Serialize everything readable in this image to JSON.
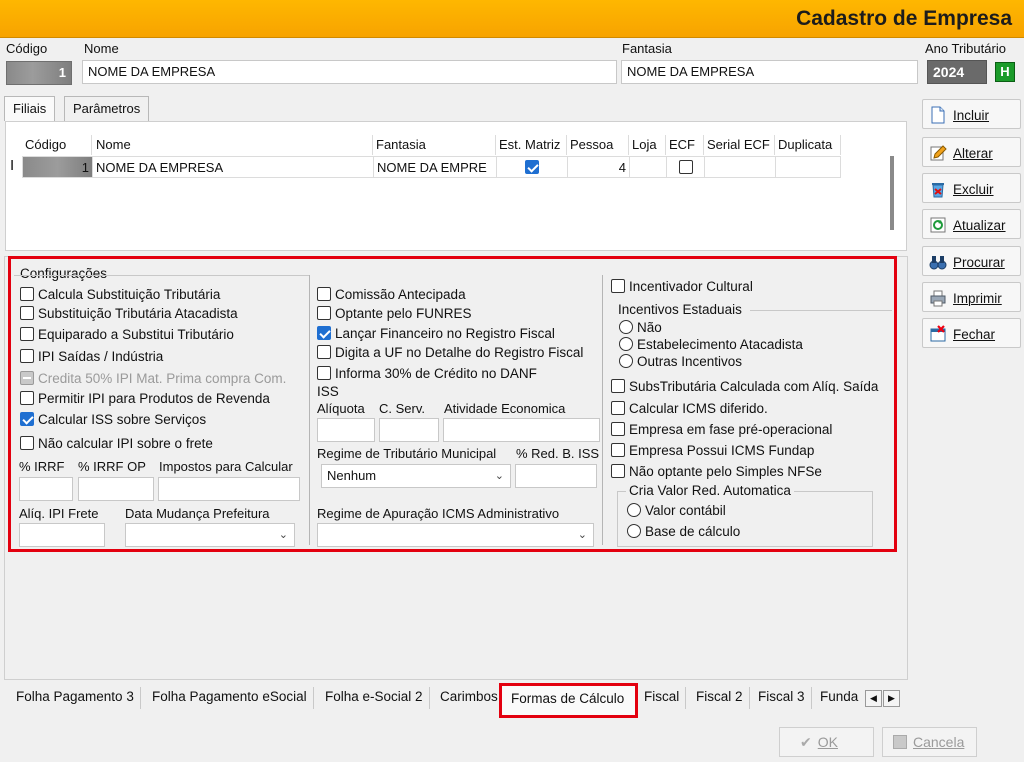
{
  "window": {
    "title": "Cadastro de Empresa"
  },
  "header": {
    "codigo_label": "Código",
    "codigo_value": "1",
    "nome_label": "Nome",
    "nome_value": "NOME DA EMPRESA",
    "fantasia_label": "Fantasia",
    "fantasia_value": "NOME DA EMPRESA",
    "ano_label": "Ano Tributário",
    "ano_value": "2024",
    "h_button": "H"
  },
  "top_tabs": [
    "Filiais",
    "Parâmetros"
  ],
  "grid": {
    "columns": [
      "Código",
      "Nome",
      "Fantasia",
      "Est. Matriz",
      "Pessoa",
      "Loja",
      "ECF",
      "Serial ECF",
      "Duplicata"
    ],
    "row": {
      "codigo": "1",
      "nome": "NOME DA EMPRESA",
      "fantasia": "NOME DA EMPRE",
      "est_matriz": true,
      "pessoa": "4",
      "loja": "",
      "ecf": false,
      "serial_ecf": "",
      "duplicata": ""
    }
  },
  "config": {
    "title": "Configurações",
    "col1": [
      {
        "label": "Calcula Substituição Tributária",
        "checked": false
      },
      {
        "label": "Substituição Tributária Atacadista",
        "checked": false
      },
      {
        "label": "Equiparado a Substitui Tributário",
        "checked": false
      },
      {
        "label": "IPI Saídas / Indústria",
        "checked": false
      },
      {
        "label": "Credita 50% IPI Mat. Prima compra Com.",
        "checked": false,
        "disabled": true
      },
      {
        "label": "Permitir IPI para Produtos de Revenda",
        "checked": false
      },
      {
        "label": "Calcular ISS sobre Serviços",
        "checked": true
      },
      {
        "label": "Não calcular IPI sobre o frete",
        "checked": false
      }
    ],
    "col1_fields": {
      "irrf": "% IRRF",
      "irrf_op": "% IRRF OP",
      "impostos": "Impostos para Calcular",
      "aliq_ipi_frete": "Alíq. IPI Frete",
      "data_mudanca": "Data Mudança Prefeitura"
    },
    "col2": [
      {
        "label": "Comissão Antecipada",
        "checked": false
      },
      {
        "label": "Optante pelo FUNRES",
        "checked": false
      },
      {
        "label": "Lançar Financeiro no Registro Fiscal",
        "checked": true
      },
      {
        "label": "Digita a UF no Detalhe do Registro Fiscal",
        "checked": false
      },
      {
        "label": "Informa 30% de Crédito no DANF",
        "checked": false
      }
    ],
    "col2_fields": {
      "iss": "ISS",
      "aliquota": "Alíquota",
      "c_serv": "C. Serv.",
      "atividade": "Atividade Economica",
      "regime_municipal": "Regime de Tributário Municipal",
      "regime_municipal_value": "Nenhum",
      "red_b_iss": "% Red. B. ISS",
      "regime_icms": "Regime de Apuração ICMS Administrativo"
    },
    "col3": {
      "incentivador": {
        "label": "Incentivador Cultural",
        "checked": false
      },
      "incentivos_title": "Incentivos Estaduais",
      "incentivos": [
        "Não",
        "Estabelecimento Atacadista",
        "Outras Incentivos"
      ],
      "checks": [
        {
          "label": "SubsTributária Calculada com Alíq. Saída",
          "checked": false
        },
        {
          "label": "Calcular ICMS diferido.",
          "checked": false
        },
        {
          "label": "Empresa em fase pré-operacional",
          "checked": false
        },
        {
          "label": "Empresa Possui ICMS Fundap",
          "checked": false
        },
        {
          "label": "Não optante pelo Simples NFSe",
          "checked": false
        }
      ],
      "cria_title": "Cria Valor Red. Automatica",
      "cria_options": [
        "Valor contábil",
        "Base de cálculo"
      ]
    }
  },
  "side_buttons": [
    "Incluir",
    "Alterar",
    "Excluir",
    "Atualizar",
    "Procurar",
    "Imprimir",
    "Fechar"
  ],
  "bottom_tabs": [
    "Folha Pagamento 3",
    "Folha Pagamento eSocial",
    "Folha e-Social 2",
    "Carimbos",
    "Formas de Cálculo",
    "Fiscal",
    "Fiscal 2",
    "Fiscal 3",
    "Funda"
  ],
  "footer": {
    "ok": "OK",
    "cancel": "Cancela"
  },
  "colors": {
    "title_bar": "#f7a300",
    "highlight": "#e3000f",
    "checked": "#1f6fd1"
  }
}
